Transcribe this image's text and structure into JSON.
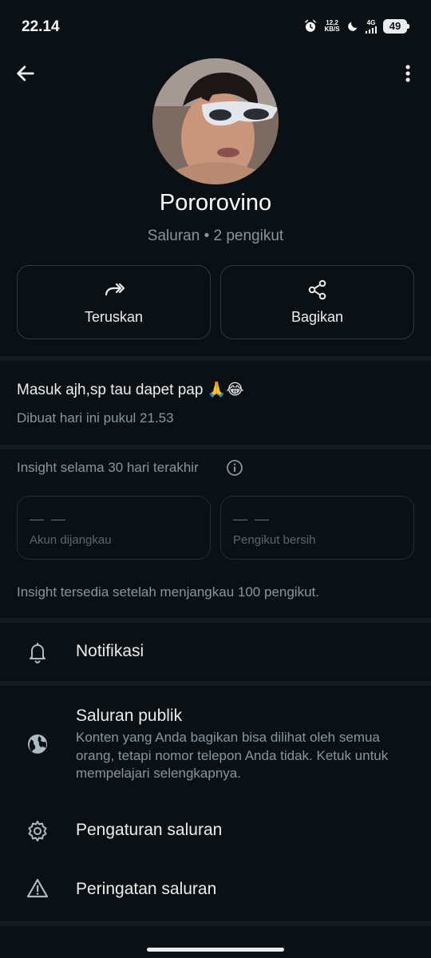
{
  "status_bar": {
    "time": "22.14",
    "net_speed_value": "12,2",
    "net_speed_unit": "KB/S",
    "network_type": "4G",
    "battery": "49"
  },
  "header": {
    "back_icon": "arrow-left-icon",
    "menu_icon": "more-vertical-icon"
  },
  "channel": {
    "name": "Pororovino",
    "subtitle": "Saluran • 2 pengikut"
  },
  "actions": [
    {
      "label": "Teruskan",
      "icon": "forward-icon"
    },
    {
      "label": "Bagikan",
      "icon": "share-icon"
    }
  ],
  "description": {
    "text": "Masuk ajh,sp tau dapet pap 🙏😂",
    "created": "Dibuat hari ini pukul 21.53"
  },
  "insights": {
    "title": "Insight selama 30 hari terakhir",
    "cards": [
      {
        "value": "— —",
        "label": "Akun dijangkau"
      },
      {
        "value": "— —",
        "label": "Pengikut bersih"
      }
    ],
    "note": "Insight tersedia setelah menjangkau 100 pengikut."
  },
  "menu": {
    "notifications": "Notifikasi",
    "public_channel_title": "Saluran publik",
    "public_channel_desc": "Konten yang Anda bagikan bisa dilihat oleh semua orang, tetapi nomor telepon Anda tidak. Ketuk untuk mempelajari selengkapnya.",
    "settings": "Pengaturan saluran",
    "warnings": "Peringatan saluran"
  },
  "colors": {
    "background": "#0b1014",
    "text_primary": "#e9edef",
    "text_secondary": "#8696a0",
    "border": "#2f3b43"
  }
}
